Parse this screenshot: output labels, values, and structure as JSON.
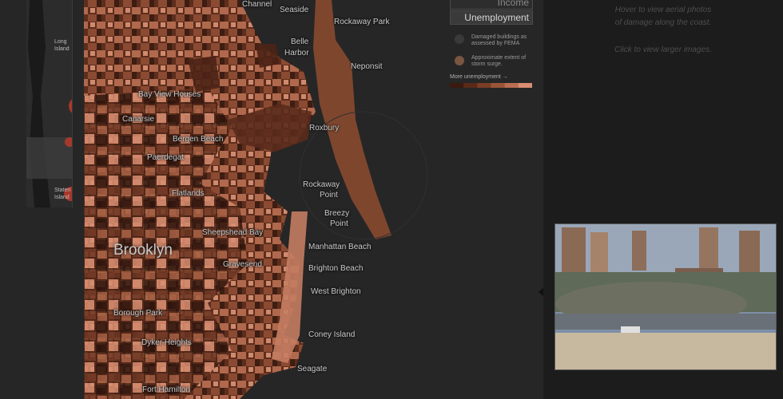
{
  "places": {
    "channel": "Channel",
    "seaside": "Seaside",
    "rockaway_park": "Rockaway Park",
    "belle": "Belle",
    "harbor": "Harbor",
    "neponsit": "Neponsit",
    "bay_view_houses": "Bay View Houses",
    "canarsie": "Canarsie",
    "roxbury": "Roxbury",
    "bergen_beach": "Bergen Beach",
    "paerdegat": "Paerdegat",
    "rockaway": "Rockaway",
    "point": "Point",
    "flatlands": "Flatlands",
    "breezy": "Breezy",
    "point2": "Point",
    "sheepshead_bay": "Sheepshead Bay",
    "manhattan_beach": "Manhattan Beach",
    "brooklyn": "Brooklyn",
    "gravesend": "Gravesend",
    "brighton_beach": "Brighton Beach",
    "west_brighton": "West Brighton",
    "borough_park": "Borough Park",
    "coney_island": "Coney Island",
    "dyker_heights": "Dyker Heights",
    "seagate": "Seagate",
    "fort_hamilton": "Fort Hamilton"
  },
  "inset": {
    "long": "Long",
    "island": "Island",
    "staten": "Staten",
    "island2": "Island"
  },
  "controls": {
    "income": "Income",
    "unemployment": "Unemployment"
  },
  "legend": {
    "damaged_1": "Damaged buildings as",
    "damaged_2": "assessed by FEMA",
    "surge_1": "Approximate extent of",
    "surge_2": "storm surge.",
    "scale_label": "More unemployment →",
    "scale_colors": [
      "#3a1a10",
      "#5a2a18",
      "#7a3e26",
      "#9a5538",
      "#b96e52",
      "#d88e72"
    ]
  },
  "hints": {
    "line1": "Hover to view aerial photos",
    "line2": "of damage along the coast.",
    "line3": "Click to view larger images."
  },
  "colors": {
    "land_dark": "#3c1c12",
    "land_light": "#d88e72",
    "surge": "#6b3522",
    "water": "#262626"
  }
}
